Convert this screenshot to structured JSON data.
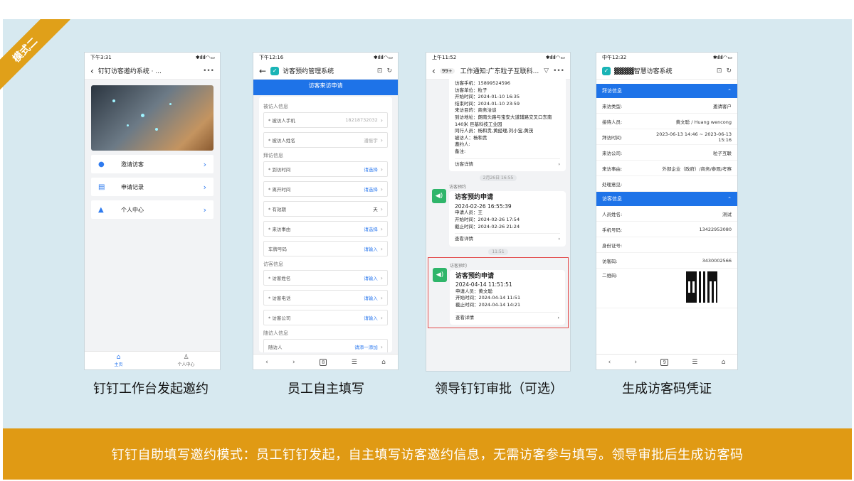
{
  "mode_tag": "模式二",
  "captions": [
    "钉钉工作台发起邀约",
    "员工自主填写",
    "领导钉钉审批（可选）",
    "生成访客码凭证"
  ],
  "banner": "钉钉自助填写邀约模式：员工钉钉发起，自主填写访客邀约信息，无需访客参与填写。领导审批后生成访客码",
  "phone1": {
    "time": "下午3:31",
    "title": "钉钉访客邀约系统 · ...",
    "menu": [
      {
        "icon": "chat-icon",
        "label": "邀请访客"
      },
      {
        "icon": "document-icon",
        "label": "申请记录"
      },
      {
        "icon": "person-icon",
        "label": "个人中心"
      }
    ],
    "tabs": [
      {
        "label": "主页"
      },
      {
        "label": "个人中心"
      }
    ]
  },
  "phone2": {
    "time": "下午12:16",
    "title": "访客预约管理系统",
    "band": "访客来访申请",
    "sections": [
      {
        "title": "被访人信息",
        "fields": [
          {
            "label": "* 被访人手机",
            "value": "18218732032",
            "style": "g"
          },
          {
            "label": "* 被访人姓名",
            "value": "潘振宇",
            "style": "g"
          }
        ]
      },
      {
        "title": "拜访信息",
        "fields": [
          {
            "label": "* 到访时间",
            "value": "请选择",
            "style": ""
          },
          {
            "label": "* 离开时间",
            "value": "请选择",
            "style": ""
          },
          {
            "label": "* 有效期",
            "value": "天",
            "style": "k"
          },
          {
            "label": "* 来访事由",
            "value": "请选择",
            "style": ""
          },
          {
            "label": "车牌号码",
            "value": "请输入",
            "style": ""
          }
        ]
      },
      {
        "title": "访客信息",
        "fields": [
          {
            "label": "* 访客姓名",
            "value": "请输入",
            "style": ""
          },
          {
            "label": "* 访客电话",
            "value": "请输入",
            "style": ""
          },
          {
            "label": "* 访客公司",
            "value": "请输入",
            "style": ""
          }
        ]
      },
      {
        "title": "随访人信息",
        "fields": [
          {
            "label": "随访人",
            "value": "请添一添加",
            "style": ""
          }
        ]
      }
    ]
  },
  "phone3": {
    "time": "上午11:52",
    "badge": "99+",
    "title": "工作通知:广东粒子互联科...",
    "top_lines": [
      "访客手机：15899524596",
      "访客单位：粒子",
      "开始时间：2024-01-10 16:35",
      "结束时间：2024-01-10 23:59",
      "来访目的：商务洽谈",
      "到访地址：朗南头路与宝安大道辅路交叉口东南140米 巨基科技工业园",
      "同行人员：杨和贵,黄经理,刘小宝,黄茂",
      "被访人：杨和贵",
      "邀约人:",
      "备注:"
    ],
    "top_link": "访客详情",
    "stamp1": "2月26日 16:55",
    "msg1": {
      "sender": "访客预约",
      "title": "访客预约申请",
      "date": "2024-02-26 16:55:39",
      "lines": [
        "申请人员：王",
        "开始时间：2024-02-26 17:54",
        "截止时间：2024-02-26 21:24"
      ],
      "link": "查看详情"
    },
    "stamp2": "11:51",
    "msg2": {
      "sender": "访客预约",
      "title": "访客预约申请",
      "date": "2024-04-14 11:51:51",
      "lines": [
        "申请人员：黄文聪",
        "开始时间：2024-04-14 11:51",
        "截止时间：2024-04-14 14:21"
      ],
      "link": "查看详情"
    }
  },
  "phone4": {
    "time": "中午12:32",
    "title": "▓▓▓▓智慧访客系统",
    "sec1": "拜访信息",
    "rows1": [
      {
        "k": "来访类型:",
        "v": "邀请客户"
      },
      {
        "k": "接待人员:",
        "v": "黄文聪 / Huang wencong"
      },
      {
        "k": "拜访时间:",
        "v": "2023-06-13 14:46 ~ 2023-06-13 15:16"
      },
      {
        "k": "来访公司:",
        "v": "粒子互联"
      },
      {
        "k": "来访事由:",
        "v": "外部企业（政府）/商务/参观/考察"
      },
      {
        "k": "处理意见:",
        "v": ""
      }
    ],
    "sec2": "访客信息",
    "rows2": [
      {
        "k": "人员姓名:",
        "v": "测试"
      },
      {
        "k": "手机号码:",
        "v": "13422953080"
      },
      {
        "k": "身份证号:",
        "v": ""
      },
      {
        "k": "访客码:",
        "v": "3430002566"
      }
    ],
    "qr_label": "二维码:"
  }
}
